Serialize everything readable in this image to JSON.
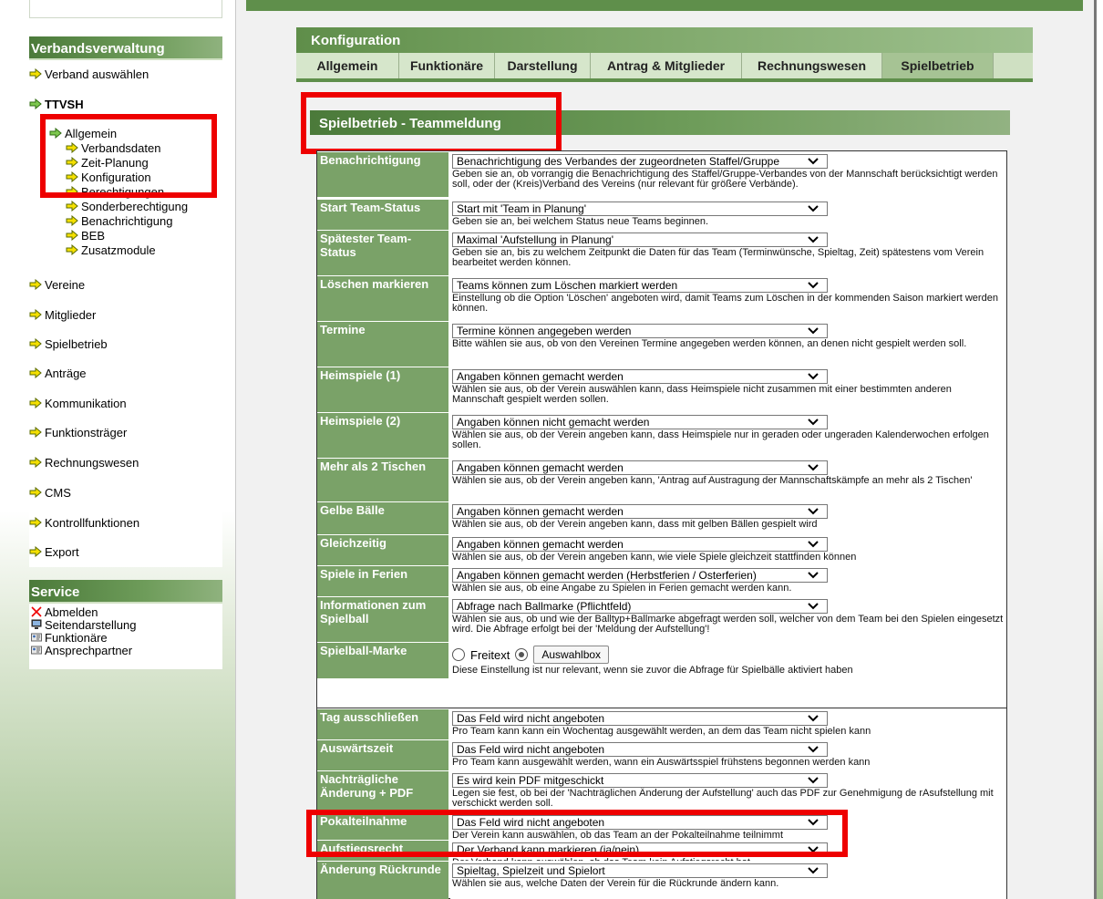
{
  "nav": {
    "title": "Verbandsverwaltung",
    "select_verband": "Verband auswählen",
    "org": "TTVSH",
    "allgemein": "Allgemein",
    "allgemein_sub": [
      "Verbandsdaten",
      "Zeit-Planung",
      "Konfiguration",
      "Berechtigungen",
      "Sonderberechtigung",
      "Benachrichtigung",
      "BEB",
      "Zusatzmodule"
    ],
    "sections": [
      "Vereine",
      "Mitglieder",
      "Spielbetrieb",
      "Anträge",
      "Kommunikation",
      "Funktionsträger",
      "Rechnungswesen",
      "CMS",
      "Kontrollfunktionen",
      "Export"
    ]
  },
  "service": {
    "title": "Service",
    "items": [
      {
        "label": "Abmelden",
        "icon": "close-icon"
      },
      {
        "label": "Seitendarstellung",
        "icon": "monitor-icon"
      },
      {
        "label": "Funktionäre",
        "icon": "contact-card-icon"
      },
      {
        "label": "Ansprechpartner",
        "icon": "contact-card-icon"
      }
    ]
  },
  "config": {
    "title": "Konfiguration",
    "tabs": [
      "Allgemein",
      "Funktionäre",
      "Darstellung",
      "Antrag & Mitglieder",
      "Rechnungswesen",
      "Spielbetrieb"
    ],
    "active_tab": "Spielbetrieb"
  },
  "section": {
    "title": "Spielbetrieb - Teammeldung"
  },
  "rows": [
    {
      "label": "Benachrichtigung",
      "select": "Benachrichtigung des Verbandes der zugeordneten Staffel/Gruppe",
      "desc": "Geben sie an, ob vorrangig die Benachrichtigung des Staffel/Gruppe-Verbandes von der Mannschaft berücksichtigt werden soll, oder der (Kreis)Verband des Vereins (nur relevant für größere Verbände)."
    },
    {
      "label": "Start Team-Status",
      "select": "Start mit 'Team in Planung'",
      "desc": "Geben sie an, bei welchem Status neue Teams beginnen."
    },
    {
      "label": "Spätester Team-Status",
      "select": "Maximal 'Aufstellung in Planung'",
      "desc": "Geben sie an, bis zu welchem Zeitpunkt die Daten für das Team (Terminwünsche, Spieltag, Zeit) spätestens vom Verein bearbeitet werden können."
    },
    {
      "label": "Löschen markieren",
      "select": "Teams können zum Löschen markiert werden",
      "desc": "Einstellung ob die Option 'Löschen' angeboten wird, damit Teams zum Löschen in der kommenden Saison markiert werden können."
    },
    {
      "label": "Termine",
      "select": "Termine können angegeben werden",
      "desc": "Bitte wählen sie aus, ob von den Vereinen Termine angegeben werden können, an denen nicht gespielt werden soll."
    },
    {
      "label": "Heimspiele (1)",
      "select": "Angaben können gemacht werden",
      "desc": "Wählen sie aus, ob der Verein auswählen kann, dass Heimspiele nicht zusammen mit einer bestimmten anderen Mannschaft gespielt werden sollen."
    },
    {
      "label": "Heimspiele (2)",
      "select": "Angaben können nicht gemacht werden",
      "desc": "Wählen sie aus, ob der Verein angeben kann, dass Heimspiele nur in geraden oder ungeraden Kalenderwochen erfolgen sollen."
    },
    {
      "label": "Mehr als 2 Tischen",
      "select": "Angaben können gemacht werden",
      "desc": "Wählen sie aus, ob der Verein angeben kann, 'Antrag auf Austragung der Mannschaftskämpfe an mehr als 2 Tischen'"
    },
    {
      "label": "Gelbe Bälle",
      "select": "Angaben können gemacht werden",
      "desc": "Wählen sie aus, ob der Verein angeben kann, dass mit gelben Bällen gespielt wird"
    },
    {
      "label": "Gleichzeitig",
      "select": "Angaben können gemacht werden",
      "desc": "Wählen sie aus, ob der Verein angeben kann, wie viele Spiele gleichzeit stattfinden können"
    },
    {
      "label": "Spiele in Ferien",
      "select": "Angaben können gemacht werden (Herbstferien / Osterferien)",
      "desc": "Wählen sie aus, ob eine Angabe zu Spielen in Ferien gemacht werden kann."
    },
    {
      "label": "Informationen zum Spielball",
      "select": "Abfrage nach Ballmarke (Pflichtfeld)",
      "desc": "Wählen sie aus, ob und wie der Balltyp+Ballmarke abgefragt werden soll, welcher von dem Team bei den Spielen eingesetzt wird. Die Abfrage erfolgt bei der 'Meldung der Aufstellung'!"
    },
    {
      "label": "Spielball-Marke",
      "radio1": "Freitext",
      "button": "Auswahlbox",
      "desc": "Diese Einstellung ist nur relevant, wenn sie zuvor die Abfrage für Spielbälle aktiviert haben"
    },
    {
      "label": "Tag ausschließen",
      "select": "Das Feld wird nicht angeboten",
      "desc": "Pro Team kann kann ein Wochentag ausgewählt werden, an dem das Team nicht spielen kann"
    },
    {
      "label": "Auswärtszeit",
      "select": "Das Feld wird nicht angeboten",
      "desc": "Pro Team kann ausgewählt werden, wann ein Auswärtsspiel frühstens begonnen werden kann"
    },
    {
      "label": "Nachträgliche Änderung + PDF",
      "select": "Es wird kein PDF mitgeschickt",
      "desc": "Legen sie fest, ob bei der 'Nachträglichen Änderung der Aufstellung' auch das PDF zur Genehmigung de rAsufstellung mit verschickt werden soll."
    },
    {
      "label": "Pokalteilnahme",
      "select": "Das Feld wird nicht angeboten",
      "desc": "Der Verein kann auswählen, ob das Team an der Pokalteilnahme teilnimmt"
    },
    {
      "label": "Aufstiegsrecht",
      "select": "Der Verband kann markieren (ja/nein)",
      "desc": "Der Verband kann auswählen, ob das Team kein Aufstiegsrecht hat."
    },
    {
      "label": "Änderung Rückrunde",
      "select": "Spieltag, Spielzeit und Spielort",
      "desc": "Wählen sie aus, welche Daten der Verein für die Rückrunde ändern kann."
    }
  ],
  "colors": {
    "highlight": "#ee0000",
    "header_green": "#5f8f4b",
    "label_green": "#7aa268"
  }
}
